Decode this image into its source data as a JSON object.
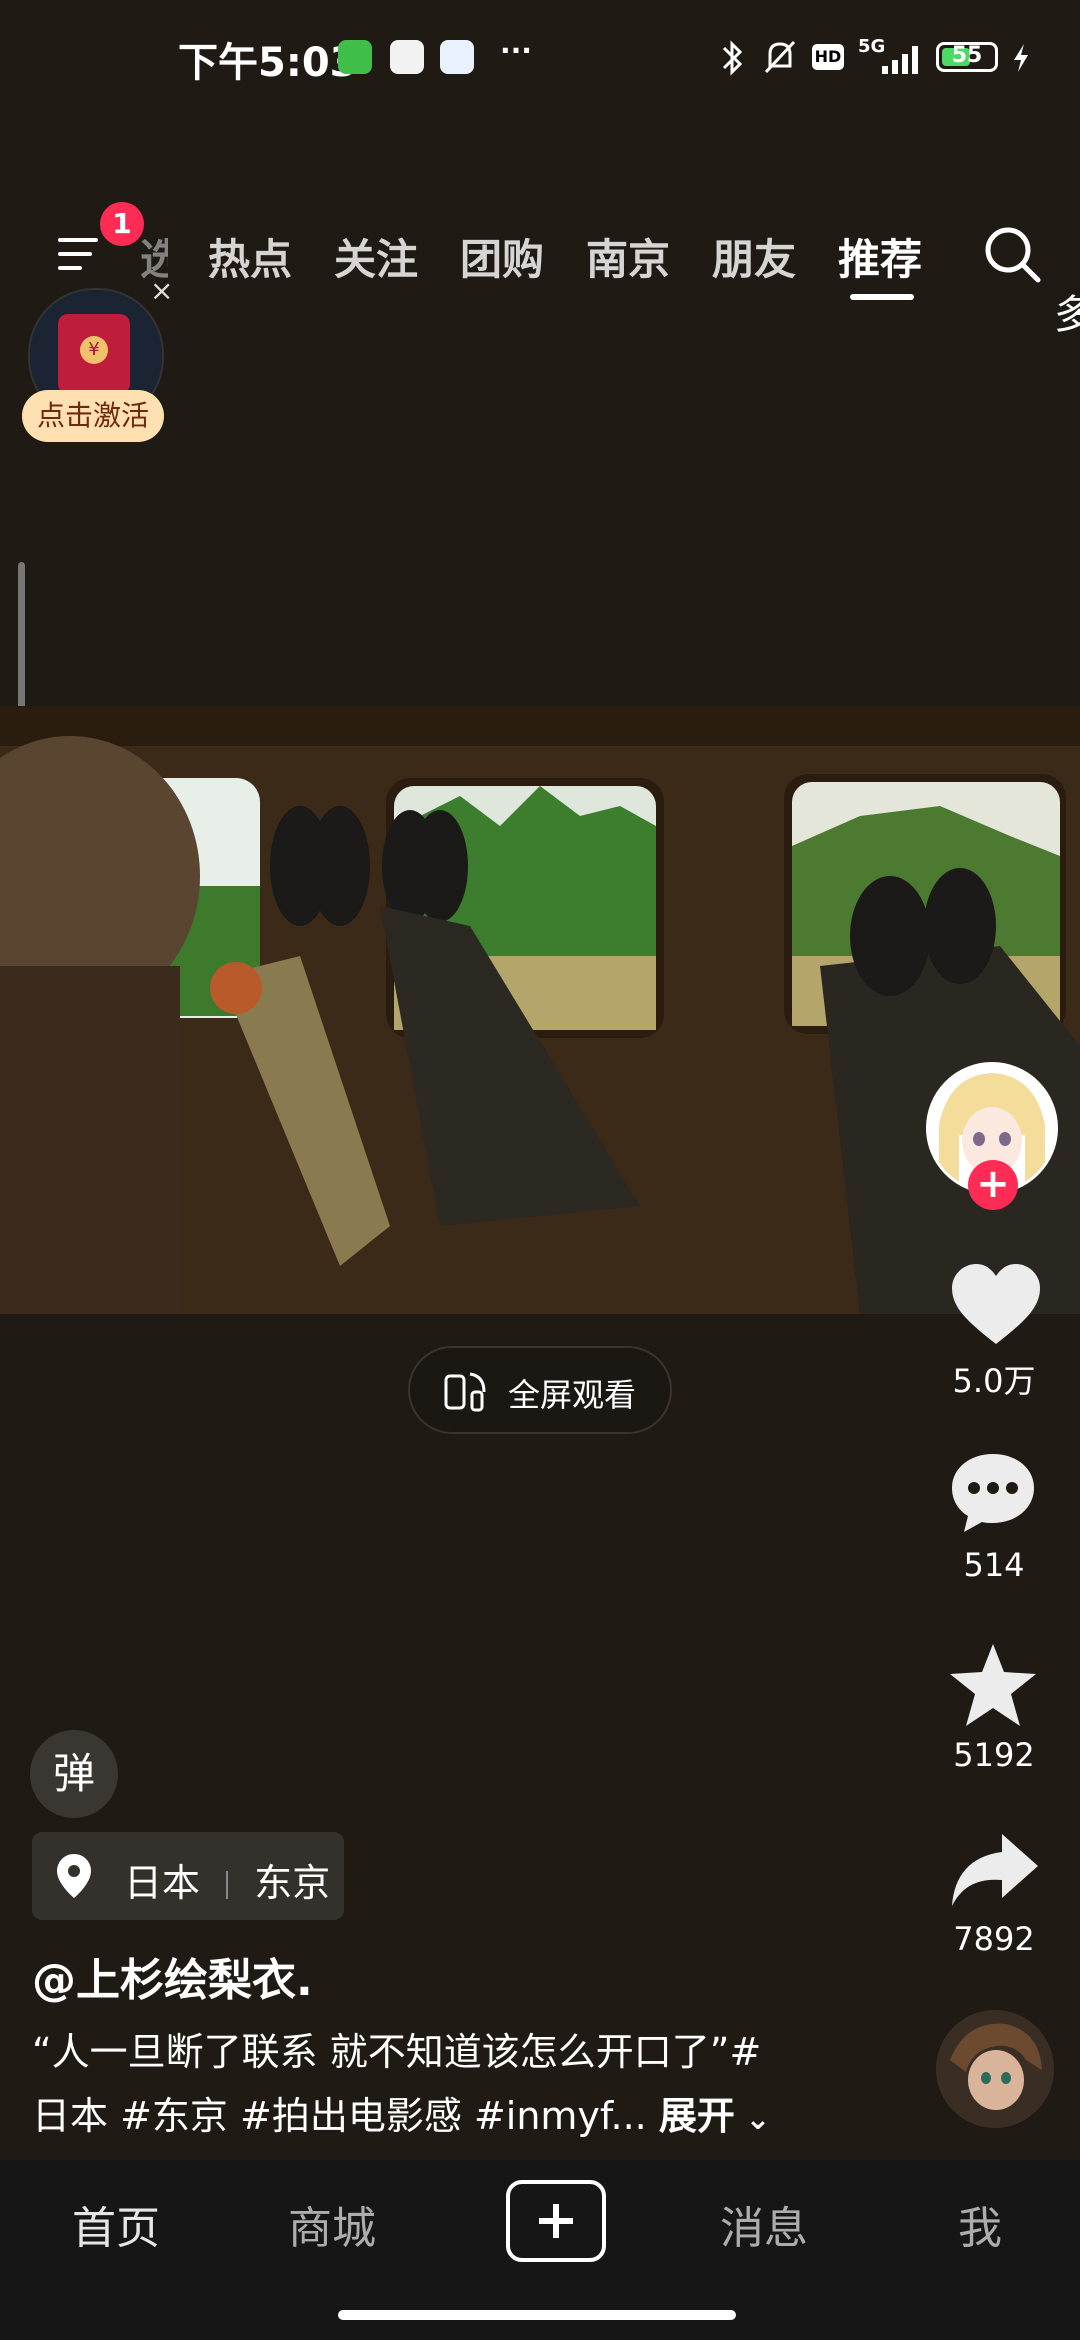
{
  "status_bar": {
    "time": "下午5:03",
    "network": "5G",
    "hd": "HD",
    "battery": "55",
    "battery_level": 0.55,
    "more": "···"
  },
  "top_nav": {
    "badge": "1",
    "tabs": [
      {
        "label": "热点"
      },
      {
        "label": "关注"
      },
      {
        "label": "团购"
      },
      {
        "label": "南京"
      },
      {
        "label": "朋友"
      },
      {
        "label": "推荐"
      }
    ],
    "active_tab": "推荐",
    "clipped_tab_fragment": "选",
    "right_peek": "多"
  },
  "red_packet": {
    "label": "点击激活",
    "close": "×"
  },
  "fullscreen_button": {
    "label": "全屏观看"
  },
  "actions": {
    "likes": "5.0万",
    "comments": "514",
    "favorites": "5192",
    "shares": "7892"
  },
  "danmu": {
    "label": "弹"
  },
  "location": {
    "country": "日本",
    "city": "东京"
  },
  "post": {
    "author": "@上杉绘梨衣.",
    "caption_line1": "“人一旦断了联系 就不知道该怎么开口了”#",
    "caption_line2": "日本 #东京 #拍出电影感 #inmyf...",
    "expand": "展开"
  },
  "bottom_nav": {
    "home": "首页",
    "mall": "商城",
    "messages": "消息",
    "me": "我"
  },
  "colors": {
    "background": "#1f1a14",
    "accent": "#fe2c55",
    "bottom_bar": "#161616"
  }
}
